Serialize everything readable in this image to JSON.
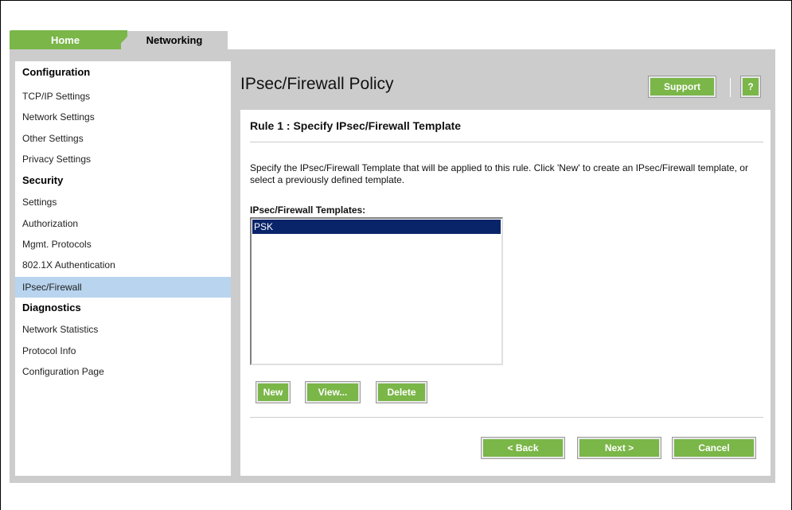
{
  "tabs": {
    "home": "Home",
    "networking": "Networking"
  },
  "sidebar": {
    "sections": [
      {
        "heading": "Configuration",
        "items": [
          "TCP/IP Settings",
          "Network Settings",
          "Other Settings",
          "Privacy Settings"
        ]
      },
      {
        "heading": "Security",
        "items": [
          "Settings",
          "Authorization",
          "Mgmt. Protocols",
          "802.1X Authentication",
          "IPsec/Firewall"
        ]
      },
      {
        "heading": "Diagnostics",
        "items": [
          "Network Statistics",
          "Protocol Info",
          "Configuration Page"
        ]
      }
    ],
    "selected": "IPsec/Firewall"
  },
  "header": {
    "title": "IPsec/Firewall Policy",
    "support_label": "Support",
    "help_label": "?"
  },
  "main": {
    "rule_title": "Rule 1 : Specify IPsec/Firewall Template",
    "description": "Specify the IPsec/Firewall Template that will be applied to this rule. Click 'New' to create an IPsec/Firewall template, or select a previously defined template.",
    "list_label": "IPsec/Firewall Templates:",
    "templates": [
      "PSK"
    ],
    "selected_template": "PSK",
    "buttons": {
      "new": "New",
      "view": "View...",
      "delete": "Delete"
    },
    "nav": {
      "back": "< Back",
      "next": "Next >",
      "cancel": "Cancel"
    }
  },
  "colors": {
    "accent_green": "#7ab648",
    "selection_blue": "#b8d4ee",
    "list_selection": "#0a246a",
    "panel_gray": "#cccccc"
  }
}
